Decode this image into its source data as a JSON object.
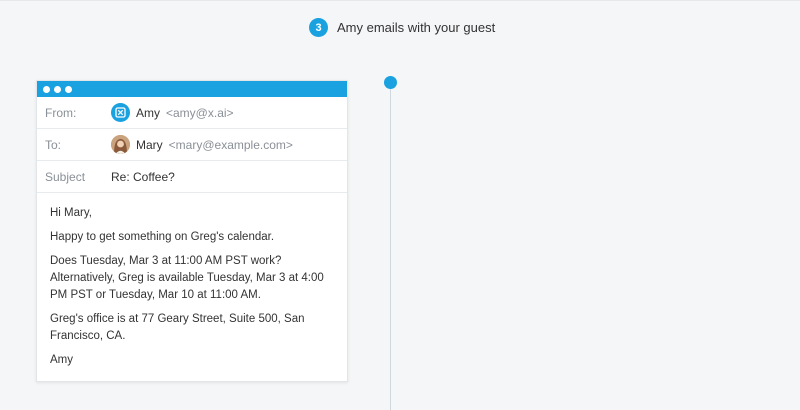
{
  "step": {
    "number": "3",
    "title": "Amy emails with your guest"
  },
  "email": {
    "from_label": "From:",
    "from_name": "Amy",
    "from_email": "<amy@x.ai>",
    "to_label": "To:",
    "to_name": "Mary",
    "to_email": "<mary@example.com>",
    "subject_label": "Subject",
    "subject": "Re: Coffee?",
    "body": {
      "greeting": "Hi Mary,",
      "p1": "Happy to get something on Greg's calendar.",
      "p2": "Does Tuesday, Mar 3 at 11:00 AM PST work? Alternatively, Greg is available Tuesday, Mar 3 at 4:00 PM PST or Tuesday, Mar 10 at 11:00 AM.",
      "p3": "Greg's office is at 77 Geary Street, Suite 500, San Francisco, CA.",
      "signature": "Amy"
    }
  },
  "colors": {
    "accent": "#1aa1e0",
    "background": "#f5f6f7",
    "timeline": "#cfd8df"
  },
  "icons": {
    "amy_avatar": "x-ai-logo-icon",
    "mary_avatar": "user-photo-icon"
  }
}
